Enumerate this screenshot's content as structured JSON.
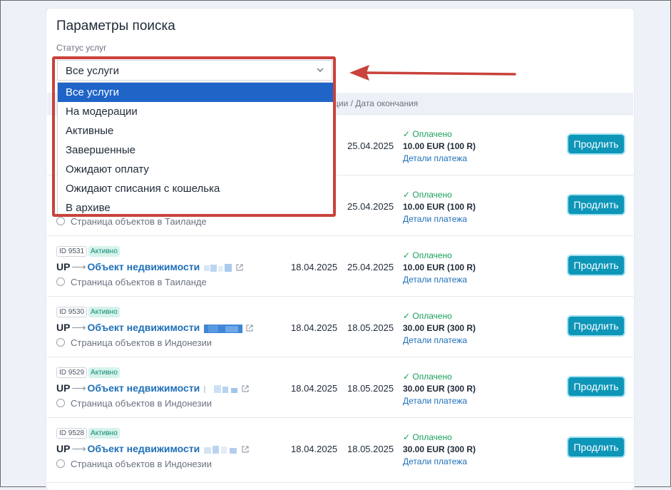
{
  "page": {
    "title": "Параметры поиска",
    "status_label": "Статус услуг",
    "select_value": "Все услуги"
  },
  "dropdown_options": [
    "Все услуги",
    "На модерации",
    "Активные",
    "Завершенные",
    "Ожидают оплату",
    "Ожидают списания с кошелька",
    "В архиве"
  ],
  "table": {
    "header_partial": "ции / Дата окончания"
  },
  "rows": [
    {
      "id": "",
      "status": "",
      "route_prefix": "",
      "object": "",
      "sub": "",
      "start": "",
      "end": "25.04.2025",
      "paid": "✓ Оплачено",
      "amount": "10.00 EUR (100 R)",
      "details": "Детали платежа",
      "button": "Продлить"
    },
    {
      "id": "",
      "status": "",
      "route_prefix": "",
      "object": "",
      "sub": "Страница объектов в Таиланде",
      "start": "",
      "end": "25.04.2025",
      "paid": "✓ Оплачено",
      "amount": "10.00 EUR (100 R)",
      "details": "Детали платежа",
      "button": "Продлить"
    },
    {
      "id": "ID 9531",
      "status": "Активно",
      "route_prefix": "UP",
      "object": "Объект недвижимости",
      "sub": "Страница объектов в Таиланде",
      "start": "18.04.2025",
      "end": "25.04.2025",
      "paid": "✓ Оплачено",
      "amount": "10.00 EUR (100 R)",
      "details": "Детали платежа",
      "button": "Продлить"
    },
    {
      "id": "ID 9530",
      "status": "Активно",
      "route_prefix": "UP",
      "object": "Объект недвижимости",
      "sub": "Страница объектов в Индонезии",
      "start": "18.04.2025",
      "end": "18.05.2025",
      "paid": "✓ Оплачено",
      "amount": "30.00 EUR (300 R)",
      "details": "Детали платежа",
      "button": "Продлить"
    },
    {
      "id": "ID 9529",
      "status": "Активно",
      "route_prefix": "UP",
      "object": "Объект недвижимости",
      "sub": "Страница объектов в Индонезии",
      "start": "18.04.2025",
      "end": "18.05.2025",
      "paid": "✓ Оплачено",
      "amount": "30.00 EUR (300 R)",
      "details": "Детали платежа",
      "button": "Продлить"
    },
    {
      "id": "ID 9528",
      "status": "Активно",
      "route_prefix": "UP",
      "object": "Объект недвижимости",
      "sub": "Страница объектов в Индонезии",
      "start": "18.04.2025",
      "end": "18.05.2025",
      "paid": "✓ Оплачено",
      "amount": "30.00 EUR (300 R)",
      "details": "Детали платежа",
      "button": "Продлить"
    }
  ],
  "colors": {
    "accent_blue": "#1f65c8",
    "button_teal": "#0e96b8",
    "annotation_red": "#c9423b",
    "paid_green": "#19a05a",
    "link_blue": "#1e6fb8"
  }
}
